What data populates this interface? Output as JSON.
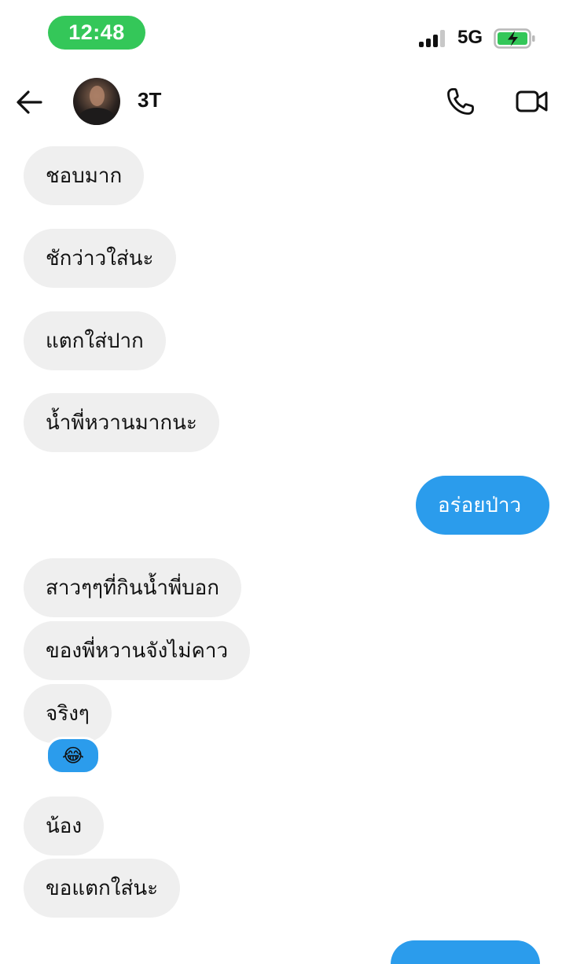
{
  "status_bar": {
    "time": "12:48",
    "network": "5G"
  },
  "header": {
    "contact_name": "3T",
    "back_icon": "arrow-left-icon",
    "call_icon": "phone-icon",
    "video_icon": "video-camera-icon"
  },
  "messages": [
    {
      "text": "ชอบมาก",
      "direction": "incoming"
    },
    {
      "text": "ชักว่าวใส่นะ",
      "direction": "incoming"
    },
    {
      "text": "แตกใส่ปาก",
      "direction": "incoming"
    },
    {
      "text": "น้ำพี่หวานมากนะ",
      "direction": "incoming"
    },
    {
      "text": "อร่อยป่าว",
      "direction": "outgoing"
    },
    {
      "text": "สาวๆๆที่กินน้ำพี่บอก",
      "direction": "incoming"
    },
    {
      "text": "ของพี่หวานจังไม่คาว",
      "direction": "incoming"
    },
    {
      "text": "จริงๆ",
      "direction": "incoming",
      "reaction": "😂"
    },
    {
      "text": "น้อง",
      "direction": "incoming"
    },
    {
      "text": "ขอแตกใส่นะ",
      "direction": "incoming"
    }
  ],
  "colors": {
    "incoming_bubble": "#efefef",
    "outgoing_bubble": "#2b9cec",
    "time_pill": "#34c759"
  }
}
